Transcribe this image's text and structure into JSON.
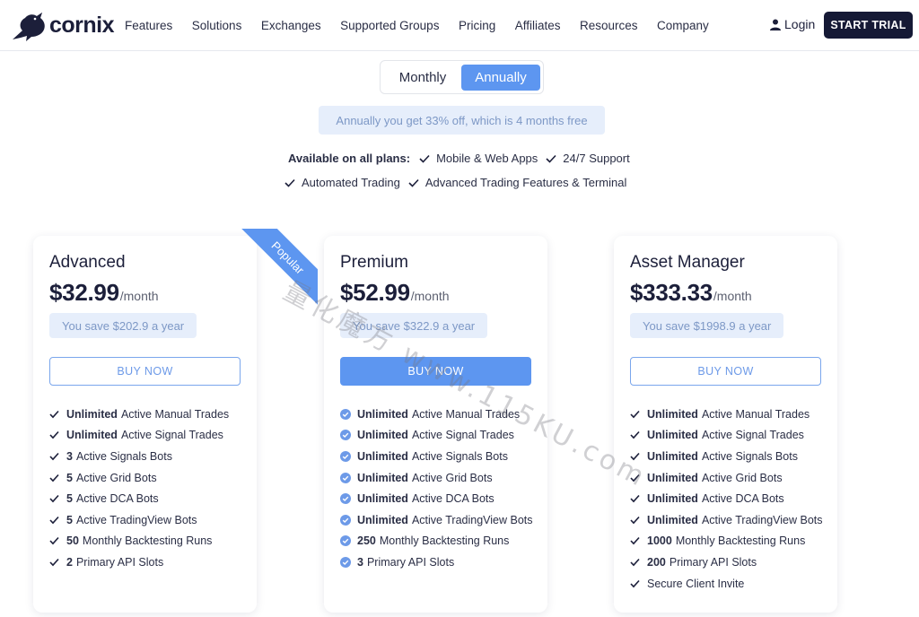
{
  "brand": {
    "name": "cornix"
  },
  "nav": {
    "links": [
      "Features",
      "Solutions",
      "Exchanges",
      "Supported Groups",
      "Pricing",
      "Affiliates",
      "Resources",
      "Company"
    ],
    "login": "Login",
    "start_trial": "START TRIAL"
  },
  "billing_toggle": {
    "monthly": "Monthly",
    "annually": "Annually",
    "selected": "Annually"
  },
  "discount_note": "Annually you get 33% off, which is 4 months free",
  "available": {
    "label": "Available on all plans:",
    "items": [
      "Mobile & Web Apps",
      "24/7 Support",
      "Automated Trading",
      "Advanced Trading Features & Terminal"
    ]
  },
  "plans": [
    {
      "name": "Advanced",
      "price": "$32.99",
      "period": "/month",
      "save": "You save $202.9 a year",
      "buy": "BUY NOW",
      "features": [
        {
          "bold": "Unlimited",
          "text": "Active Manual Trades"
        },
        {
          "bold": "Unlimited",
          "text": "Active Signal Trades"
        },
        {
          "bold": "3",
          "text": "Active Signals Bots"
        },
        {
          "bold": "5",
          "text": "Active Grid Bots"
        },
        {
          "bold": "5",
          "text": "Active DCA Bots"
        },
        {
          "bold": "5",
          "text": "Active TradingView Bots"
        },
        {
          "bold": "50",
          "text": "Monthly Backtesting Runs"
        },
        {
          "bold": "2",
          "text": "Primary API Slots"
        }
      ]
    },
    {
      "name": "Premium",
      "badge": "Popular",
      "price": "$52.99",
      "period": "/month",
      "save": "You save $322.9 a year",
      "buy": "BUY NOW",
      "features": [
        {
          "bold": "Unlimited",
          "text": "Active Manual Trades"
        },
        {
          "bold": "Unlimited",
          "text": "Active Signal Trades"
        },
        {
          "bold": "Unlimited",
          "text": "Active Signals Bots"
        },
        {
          "bold": "Unlimited",
          "text": "Active Grid Bots"
        },
        {
          "bold": "Unlimited",
          "text": "Active DCA Bots"
        },
        {
          "bold": "Unlimited",
          "text": "Active TradingView Bots"
        },
        {
          "bold": "250",
          "text": "Monthly Backtesting Runs"
        },
        {
          "bold": "3",
          "text": "Primary API Slots"
        }
      ]
    },
    {
      "name": "Asset Manager",
      "price": "$333.33",
      "period": "/month",
      "save": "You save $1998.9 a year",
      "buy": "BUY NOW",
      "features": [
        {
          "bold": "Unlimited",
          "text": "Active Manual Trades"
        },
        {
          "bold": "Unlimited",
          "text": "Active Signal Trades"
        },
        {
          "bold": "Unlimited",
          "text": "Active Signals Bots"
        },
        {
          "bold": "Unlimited",
          "text": "Active Grid Bots"
        },
        {
          "bold": "Unlimited",
          "text": "Active DCA Bots"
        },
        {
          "bold": "Unlimited",
          "text": "Active TradingView Bots"
        },
        {
          "bold": "1000",
          "text": "Monthly Backtesting Runs"
        },
        {
          "bold": "200",
          "text": "Primary API Slots"
        },
        {
          "bold": "",
          "text": "Secure Client Invite"
        }
      ]
    }
  ],
  "watermark": "量化魔方 www.115KU.com",
  "colors": {
    "accent": "#5d96f0",
    "dark": "#151935",
    "muted_bg": "#e6eefb",
    "muted_text": "#7d98c6"
  },
  "icons": {
    "logo": "raven-icon",
    "login": "user-icon",
    "check": "check-icon",
    "check_circle": "check-circle-icon"
  }
}
